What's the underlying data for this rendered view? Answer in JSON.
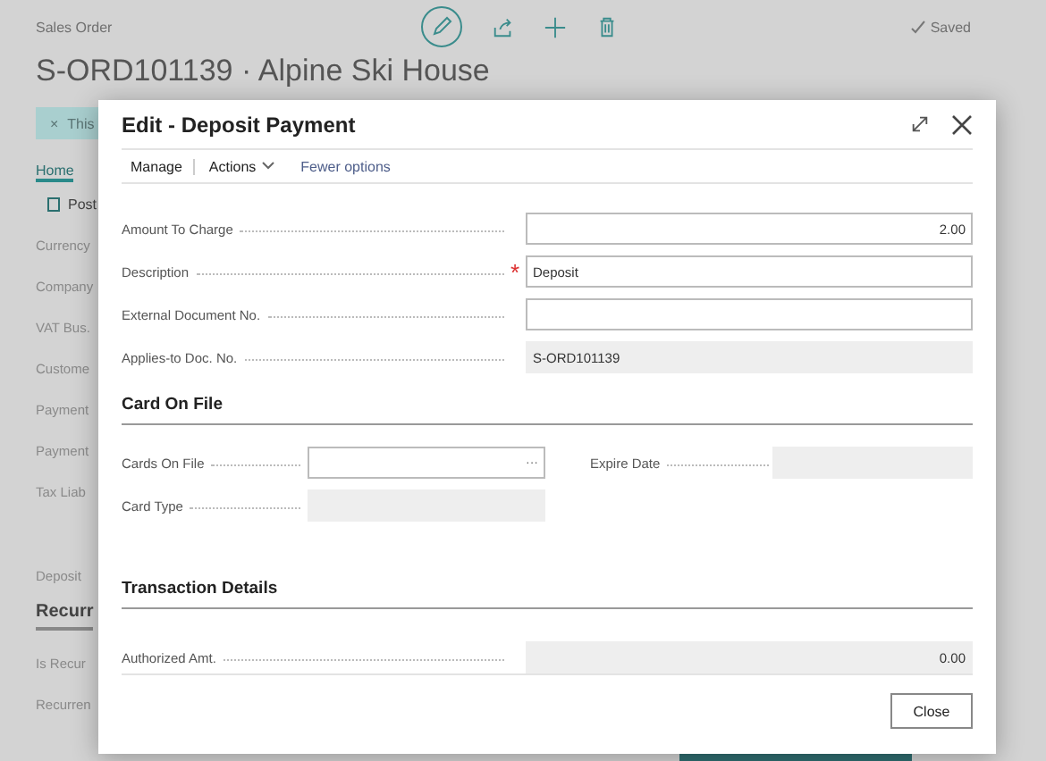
{
  "page": {
    "caption": "Sales Order",
    "title": "S-ORD101139 · Alpine Ski House",
    "status": "Saved",
    "banner": {
      "close": "×",
      "text": "This"
    },
    "tab": "Home",
    "action": "Post",
    "labels": [
      "Currency",
      "Company",
      "VAT Bus.",
      "Custome",
      "Payment",
      "Payment",
      "Tax Liab"
    ],
    "deposit_label": "Deposit",
    "section": "Recurr",
    "labels_2": [
      "Is Recur",
      "Recurren"
    ]
  },
  "dialog": {
    "title": "Edit - Deposit Payment",
    "toolbar": [
      {
        "label": "Manage",
        "kind": "tab"
      },
      {
        "label": "Actions",
        "kind": "menu"
      },
      {
        "label": "Fewer options",
        "kind": "link"
      }
    ],
    "fields": [
      {
        "label": "Amount To Charge",
        "value": "2.00",
        "kind": "number"
      },
      {
        "label": "Description",
        "value": "Deposit",
        "kind": "text",
        "marker": "*"
      },
      {
        "label": "External Document No.",
        "kind": "text"
      },
      {
        "label": "Applies-to Doc. No.",
        "value": "S-ORD101139",
        "kind": "readonly"
      }
    ],
    "card_section": {
      "title": "Card On File",
      "cards_on_file": {
        "label": "Cards On File",
        "lookup": "···"
      },
      "expire_date": {
        "label": "Expire Date"
      },
      "card_type": {
        "label": "Card Type"
      }
    },
    "transaction_section": {
      "title": "Transaction Details",
      "fields": [
        {
          "label": "Authorized Amt.",
          "value": "0.00",
          "kind": "readonly_number"
        }
      ]
    },
    "buttons": [
      "Close"
    ]
  }
}
